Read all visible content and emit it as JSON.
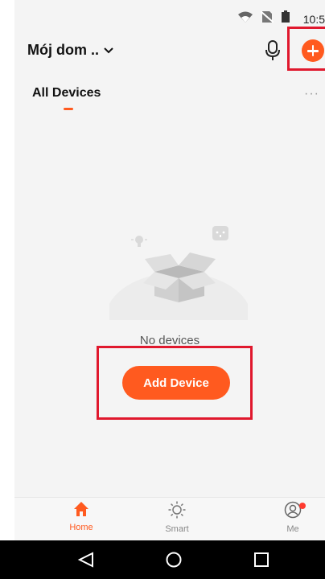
{
  "status_bar": {
    "time": "10:5",
    "icons": [
      "wifi-icon",
      "no-sim-icon",
      "battery-icon"
    ]
  },
  "header": {
    "home_name": "Mój dom ..",
    "icons": [
      "chevron-down-icon",
      "microphone-icon",
      "plus-icon"
    ]
  },
  "tabs": {
    "active": "All Devices",
    "more": "···"
  },
  "empty_state": {
    "message": "No devices",
    "button_label": "Add Device"
  },
  "bottom_nav": {
    "items": [
      {
        "label": "Home",
        "icon": "home-icon",
        "active": true
      },
      {
        "label": "Smart",
        "icon": "sun-icon",
        "active": false
      },
      {
        "label": "Me",
        "icon": "profile-icon",
        "active": false
      }
    ]
  },
  "system_nav": {
    "icons": [
      "back-icon",
      "home-circle-icon",
      "recents-icon"
    ]
  },
  "colors": {
    "accent": "#ff5a1f",
    "highlight": "#e0182d",
    "background": "#f4f4f4"
  }
}
